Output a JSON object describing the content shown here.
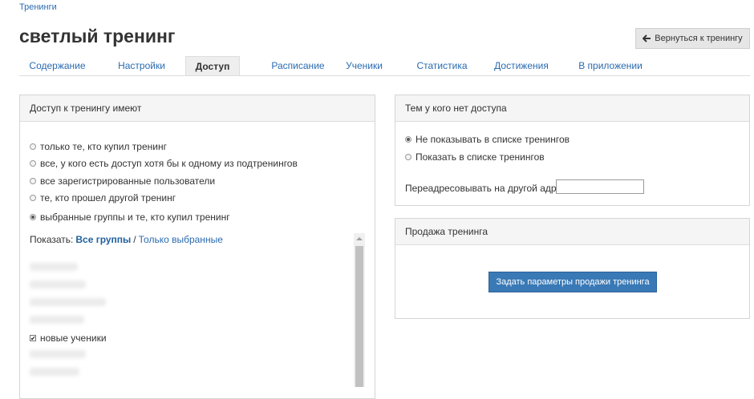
{
  "breadcrumb": "Тренинги",
  "title": "светлый тренинг",
  "back_button": "Вернуться к тренингу",
  "tabs": [
    {
      "label": "Содержание"
    },
    {
      "label": "Настройки"
    },
    {
      "label": "Доступ"
    },
    {
      "label": "Расписание"
    },
    {
      "label": "Ученики"
    },
    {
      "label": "Статистика"
    },
    {
      "label": "Достижения"
    },
    {
      "label": "В приложении"
    }
  ],
  "active_tab": "Доступ",
  "access_panel": {
    "title": "Доступ к тренингу имеют",
    "options": [
      {
        "label": "только те, кто купил тренинг",
        "selected": false
      },
      {
        "label": "все, у кого есть доступ хотя бы к одному из подтренингов",
        "selected": false
      },
      {
        "label": "все зарегистрированные пользователи",
        "selected": false
      },
      {
        "label": "те, кто прошел другой тренинг",
        "selected": false
      },
      {
        "label": "выбранные группы и те, кто купил тренинг",
        "selected": true
      }
    ],
    "show_prefix": "Показать:",
    "show_all": "Все группы",
    "show_separator": "/",
    "show_selected": "Только выбранные",
    "groups": [
      {
        "label": "новые ученики",
        "checked": true
      }
    ]
  },
  "no_access_panel": {
    "title": "Тем у кого нет доступа",
    "options": [
      {
        "label": "Не показывать в списке тренингов",
        "selected": true
      },
      {
        "label": "Показать в списке тренингов",
        "selected": false
      }
    ],
    "redirect_label": "Переадресовывать на другой адрес",
    "redirect_value": ""
  },
  "sale_panel": {
    "title": "Продажа тренинга",
    "button": "Задать параметры продажи тренинга"
  },
  "colors": {
    "link": "#2a6bb0",
    "primary_button": "#3979b6"
  },
  "icons": {
    "back": "arrow-left-icon"
  }
}
